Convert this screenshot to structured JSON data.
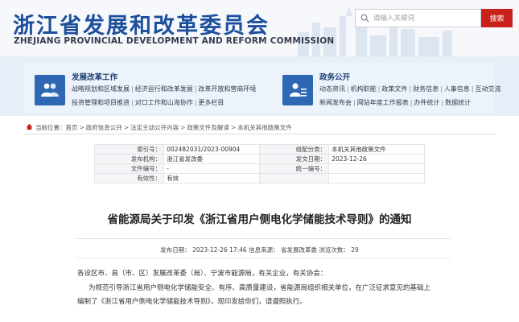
{
  "header": {
    "title": "浙江省发展和改革委员会",
    "subtitle": "ZHEJIANG PROVINCIAL DEVELOPMENT AND REFORM COMMISSION",
    "search_placeholder": "请输入关键词",
    "search_button": "搜索"
  },
  "nav": {
    "left": {
      "heading": "发展改革工作",
      "row1": [
        "战略规划和区域发展",
        "经济运行和改革发展",
        "改革开放和营商环境"
      ],
      "row2": [
        "投资管理和项目推进",
        "对口工作和山海协作",
        "更多栏目"
      ]
    },
    "right": {
      "heading": "政务公开",
      "row1": [
        "动态资讯",
        "机构职能",
        "政策文件",
        "财务信息",
        "人事信息",
        "互动交流"
      ],
      "row2": [
        "新闻发布会",
        "网站年度工作报表",
        "办件统计",
        "数据统计"
      ]
    }
  },
  "breadcrumb": {
    "label": "当前位置：",
    "items": [
      "首页",
      "政府信息公开",
      "法定主动公开内容",
      "政策文件及解读",
      "本机关其他政策文件"
    ]
  },
  "meta": {
    "rows": [
      [
        "索引号：",
        "002482031/2023-00904",
        "组配分类：",
        "本机关其他政策文件"
      ],
      [
        "发布机构：",
        "浙江省发改委",
        "发文日期：",
        "2023-12-26"
      ],
      [
        "文件编号：",
        "-",
        "统一编号：",
        ""
      ],
      [
        "有效性：",
        "有效",
        "",
        ""
      ]
    ]
  },
  "article": {
    "title": "省能源局关于印发《浙江省用户侧电化学储能技术导则》的通知",
    "info": "发布日期： 2023-12-26 17:46    信息来源： 省发展改革委    浏览次数： 29",
    "para1": "各设区市、县（市、区）发展改革委（局）、宁波市能源局，有关企业，有关协会：",
    "para2_line1": "为规范引导浙江省用户侧电化学储能安全、有序、高质量建设，省能源局组织相关单位，在广泛征求意见的基础上",
    "para2_line2": "编制了《浙江省用户侧电化学储能技术导则》，现印发给你们，请遵照执行。"
  },
  "colors": {
    "brand_blue": "#1c4f9c",
    "search_red": "#c8211b",
    "nav_bg": "#e7eef8"
  }
}
